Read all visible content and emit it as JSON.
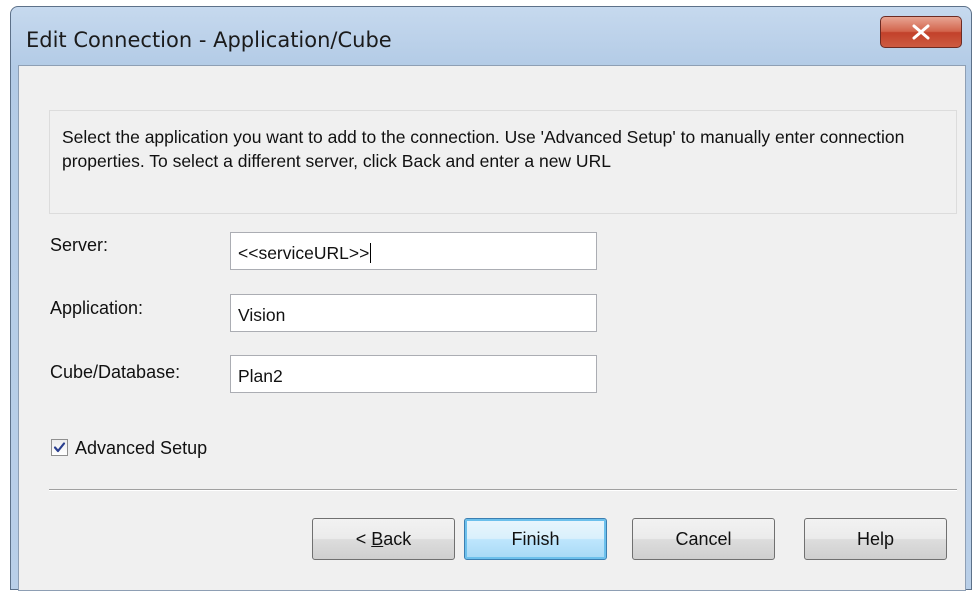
{
  "window": {
    "title": "Edit Connection - Application/Cube",
    "close_glyph": "X"
  },
  "description": {
    "text": "Select the application you want to add to the connection. Use 'Advanced Setup' to manually enter connection properties. To select a different server, click Back and enter a new URL"
  },
  "fields": {
    "server": {
      "label": "Server:",
      "value": "<<serviceURL>>"
    },
    "application": {
      "label": "Application:",
      "value": "Vision"
    },
    "cube": {
      "label": "Cube/Database:",
      "value": "Plan2"
    }
  },
  "advanced_setup": {
    "label": "Advanced Setup",
    "checked": true
  },
  "buttons": {
    "back_prefix": "< ",
    "back_mnemonic": "B",
    "back_rest": "ack",
    "finish": "Finish",
    "cancel": "Cancel",
    "help": "Help"
  },
  "colors": {
    "close_button": "#c2412a",
    "default_button_border": "#3c7fb1",
    "title_bar": "#b9cfe8"
  },
  "icons": {
    "close": "close-icon",
    "check": "checkmark-icon"
  }
}
